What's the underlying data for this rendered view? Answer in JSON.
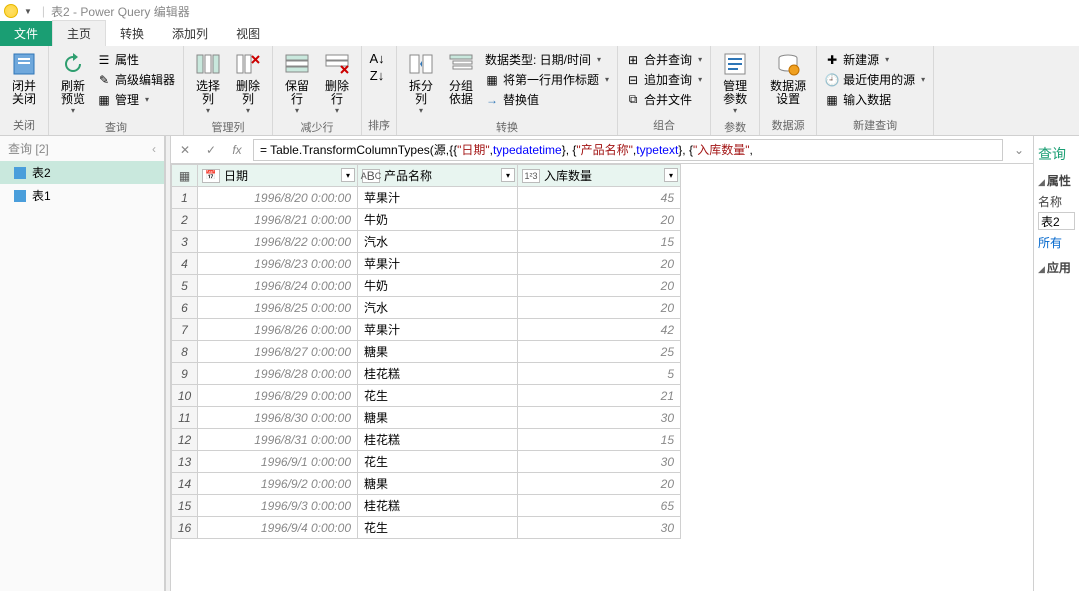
{
  "title": {
    "app": "表2 - Power Query 编辑器"
  },
  "tabs": {
    "file": "文件",
    "home": "主页",
    "transform": "转换",
    "addcol": "添加列",
    "view": "视图"
  },
  "ribbon": {
    "close": {
      "label": "闭并\n关闭",
      "group": "关闭"
    },
    "refresh": {
      "label": "刷新\n预览",
      "props": "属性",
      "adv": "高级编辑器",
      "manage": "管理",
      "group": "查询"
    },
    "cols": {
      "choose": "选择\n列",
      "remove": "删除\n列",
      "group": "管理列"
    },
    "rows": {
      "keep": "保留\n行",
      "remove": "删除\n行",
      "group": "减少行"
    },
    "sort": {
      "group": "排序"
    },
    "split": {
      "split": "拆分\n列",
      "group2": "分组\n依据",
      "dtype": "数据类型: 日期/时间",
      "firstrow": "将第一行用作标题",
      "replace": "替换值",
      "group": "转换"
    },
    "combine": {
      "merge": "合并查询",
      "append": "追加查询",
      "files": "合并文件",
      "group": "组合"
    },
    "params": {
      "label": "管理\n参数",
      "group": "参数"
    },
    "ds": {
      "label": "数据源\n设置",
      "group": "数据源"
    },
    "newq": {
      "new": "新建源",
      "recent": "最近使用的源",
      "input": "输入数据",
      "group": "新建查询"
    }
  },
  "queries": {
    "header": "查询",
    "count": "[2]",
    "items": [
      "表2",
      "表1"
    ]
  },
  "formula": {
    "prefix": "= Table.TransformColumnTypes(源,{{",
    "s1": "\"日期\"",
    "m1": ", ",
    "k1": "type",
    "sp": " ",
    "t1": "datetime",
    "m2": "}, {",
    "s2": "\"产品名称\"",
    "k2": "type",
    "t2": "text",
    "m3": "}, {",
    "s3": "\"入库数量\"",
    "m4": ","
  },
  "columns": [
    {
      "name": "日期",
      "type": "date"
    },
    {
      "name": "产品名称",
      "type": "text"
    },
    {
      "name": "入库数量",
      "type": "int"
    }
  ],
  "rows": [
    {
      "d": "1996/8/20 0:00:00",
      "n": "苹果汁",
      "q": 45
    },
    {
      "d": "1996/8/21 0:00:00",
      "n": "牛奶",
      "q": 20
    },
    {
      "d": "1996/8/22 0:00:00",
      "n": "汽水",
      "q": 15
    },
    {
      "d": "1996/8/23 0:00:00",
      "n": "苹果汁",
      "q": 20
    },
    {
      "d": "1996/8/24 0:00:00",
      "n": "牛奶",
      "q": 20
    },
    {
      "d": "1996/8/25 0:00:00",
      "n": "汽水",
      "q": 20
    },
    {
      "d": "1996/8/26 0:00:00",
      "n": "苹果汁",
      "q": 42
    },
    {
      "d": "1996/8/27 0:00:00",
      "n": "糖果",
      "q": 25
    },
    {
      "d": "1996/8/28 0:00:00",
      "n": "桂花糕",
      "q": 5
    },
    {
      "d": "1996/8/29 0:00:00",
      "n": "花生",
      "q": 21
    },
    {
      "d": "1996/8/30 0:00:00",
      "n": "糖果",
      "q": 30
    },
    {
      "d": "1996/8/31 0:00:00",
      "n": "桂花糕",
      "q": 15
    },
    {
      "d": "1996/9/1 0:00:00",
      "n": "花生",
      "q": 30
    },
    {
      "d": "1996/9/2 0:00:00",
      "n": "糖果",
      "q": 20
    },
    {
      "d": "1996/9/3 0:00:00",
      "n": "桂花糕",
      "q": 65
    },
    {
      "d": "1996/9/4 0:00:00",
      "n": "花生",
      "q": 30
    }
  ],
  "right": {
    "title": "查询",
    "props": "属性",
    "name": "名称",
    "nameval": "表2",
    "all": "所有",
    "applied": "应用"
  }
}
